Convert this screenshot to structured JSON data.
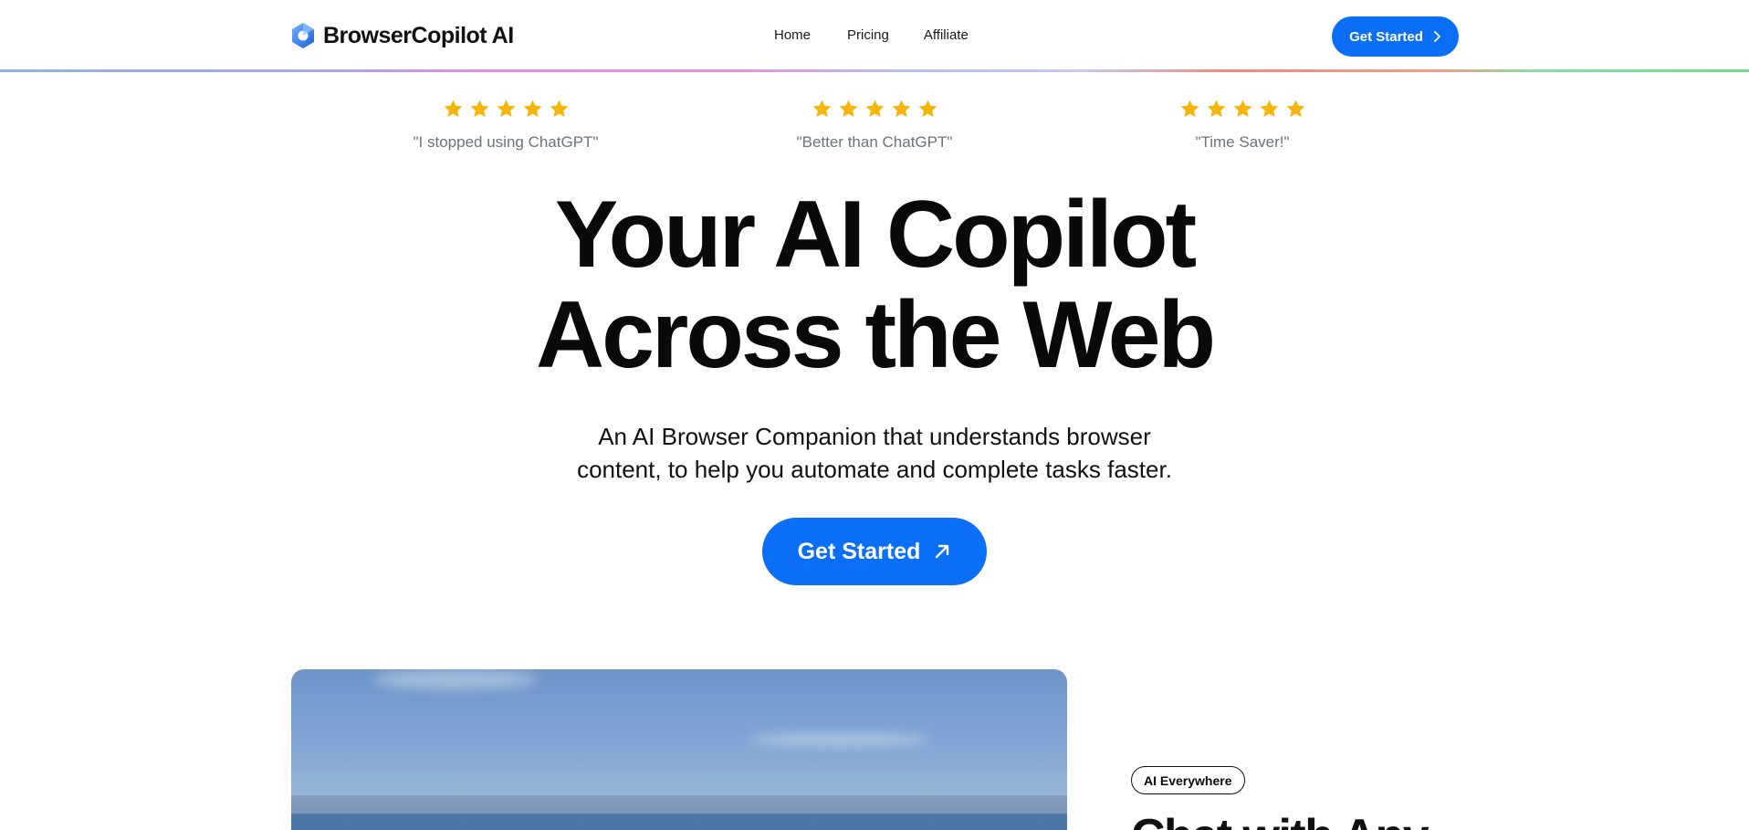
{
  "nav": {
    "logo_text": "BrowserCopilot AI",
    "links": [
      "Home",
      "Pricing",
      "Affiliate"
    ],
    "cta_label": "Get Started"
  },
  "testimonials": [
    {
      "rating": 5,
      "quote": "\"I stopped using ChatGPT\""
    },
    {
      "rating": 5,
      "quote": "\"Better than ChatGPT\""
    },
    {
      "rating": 5,
      "quote": "\"Time Saver!\""
    }
  ],
  "hero": {
    "title_line1": "Your AI Copilot",
    "title_line2": "Across the Web",
    "subtitle_line1": "An AI Browser Companion that understands browser",
    "subtitle_line2": "content, to help you automate and complete tasks faster.",
    "cta_label": "Get Started"
  },
  "feature": {
    "badge": "AI Everywhere",
    "title": "Chat with Any"
  },
  "colors": {
    "accent": "#0b6ef7",
    "star": "#f5b50a",
    "quote_text": "#6b7280"
  }
}
